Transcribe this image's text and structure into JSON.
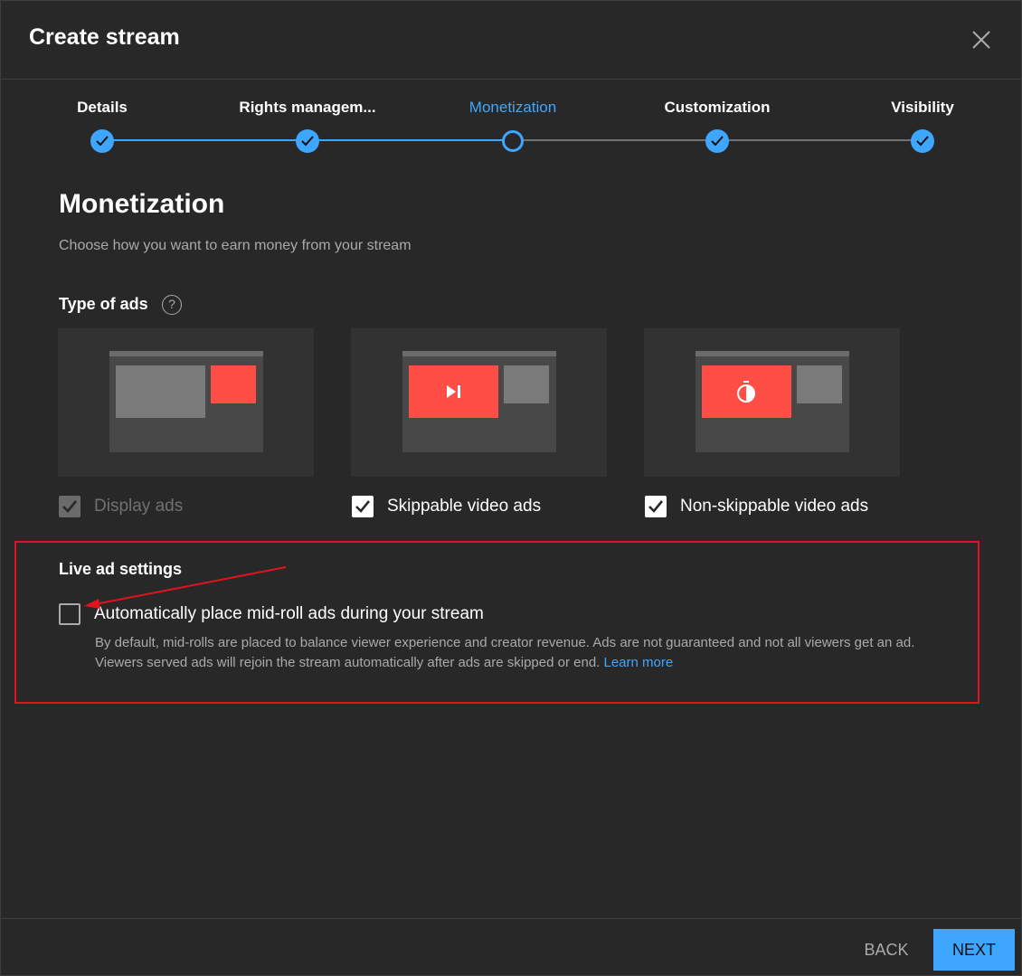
{
  "dialog": {
    "title": "Create stream"
  },
  "stepper": {
    "steps": [
      {
        "label": "Details",
        "state": "done"
      },
      {
        "label": "Rights managem...",
        "state": "done"
      },
      {
        "label": "Monetization",
        "state": "current"
      },
      {
        "label": "Customization",
        "state": "done"
      },
      {
        "label": "Visibility",
        "state": "done"
      }
    ]
  },
  "monetization": {
    "title": "Monetization",
    "subtitle": "Choose how you want to earn money from your stream",
    "type_of_ads_label": "Type of ads",
    "help_icon": "?",
    "ad_types": [
      {
        "label": "Display ads",
        "checked": true,
        "disabled": true
      },
      {
        "label": "Skippable video ads",
        "checked": true,
        "disabled": false
      },
      {
        "label": "Non-skippable video ads",
        "checked": true,
        "disabled": false
      }
    ]
  },
  "live_ad_settings": {
    "title": "Live ad settings",
    "midroll_label": "Automatically place mid-roll ads during your stream",
    "midroll_checked": false,
    "description": "By default, mid-rolls are placed to balance viewer experience and creator revenue. Ads are not guaranteed and not all viewers get an ad. Viewers served ads will rejoin the stream automatically after ads are skipped or end.",
    "learn_more": "Learn more"
  },
  "footer": {
    "back_label": "BACK",
    "next_label": "NEXT"
  },
  "colors": {
    "accent": "#3ea6ff",
    "ad_red": "#ff4e45",
    "highlight_red": "#e0131e",
    "background": "#282828"
  }
}
